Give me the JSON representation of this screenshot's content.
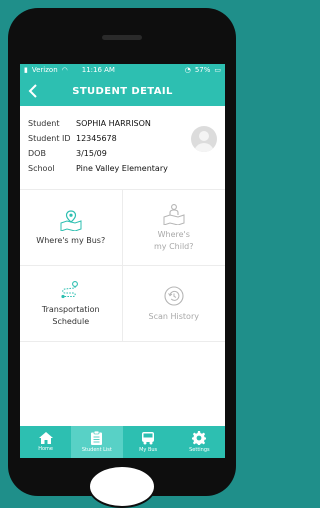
{
  "status_bar": {
    "carrier": "Verizon",
    "time": "11:16 AM",
    "battery": "57%"
  },
  "header": {
    "title": "STUDENT DETAIL"
  },
  "student": [
    {
      "label": "Student",
      "value": "SOPHIA HARRISON"
    },
    {
      "label": "Student ID",
      "value": "12345678"
    },
    {
      "label": "DOB",
      "value": "3/15/09"
    },
    {
      "label": "School",
      "value": "Pine Valley Elementary"
    }
  ],
  "tiles": [
    {
      "label": "Where's my Bus?",
      "icon": "bus-map-icon",
      "enabled": true
    },
    {
      "label": "Where's\nmy Child?",
      "icon": "child-map-icon",
      "enabled": false
    },
    {
      "label": "Transportation\nSchedule",
      "icon": "route-schedule-icon",
      "enabled": true
    },
    {
      "label": "Scan History",
      "icon": "history-icon",
      "enabled": false
    }
  ],
  "tabs": [
    {
      "label": "Home",
      "icon": "home-icon",
      "active": false
    },
    {
      "label": "Student List",
      "icon": "clipboard-icon",
      "active": true
    },
    {
      "label": "My Bus",
      "icon": "bus-icon",
      "active": false
    },
    {
      "label": "Settings",
      "icon": "gear-icon",
      "active": false
    }
  ],
  "colors": {
    "background": "#1f8f8a",
    "accent": "#2dbfb1",
    "active_tab": "#58d1c6"
  }
}
